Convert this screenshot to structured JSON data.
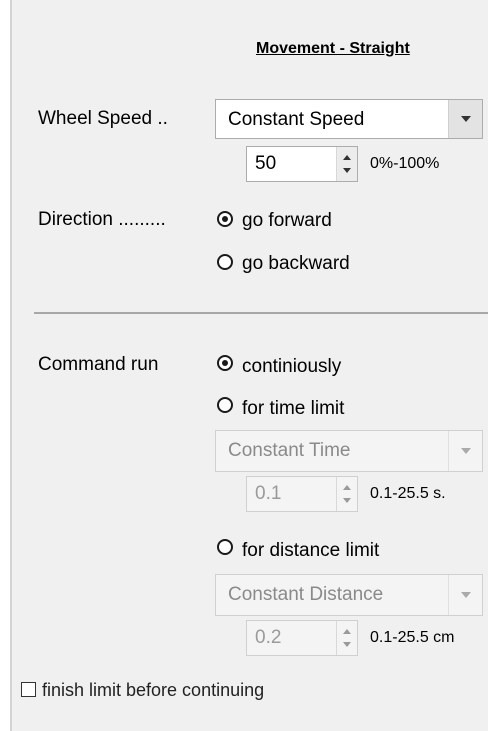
{
  "panel": {
    "title": "Movement - Straight"
  },
  "wheel_speed": {
    "label": "Wheel Speed ..",
    "mode": "Constant Speed",
    "value": "50",
    "range": "0%-100%"
  },
  "direction": {
    "label": "Direction .........",
    "options": [
      {
        "label": "go forward",
        "selected": true
      },
      {
        "label": "go backward",
        "selected": false
      }
    ]
  },
  "command_run": {
    "label": "Command run",
    "options": [
      {
        "label": "continiously",
        "selected": true
      },
      {
        "label": "for time limit",
        "selected": false
      },
      {
        "label": "for distance limit",
        "selected": false
      }
    ],
    "time": {
      "mode": "Constant Time",
      "value": "0.1",
      "range": "0.1-25.5 s."
    },
    "distance": {
      "mode": "Constant Distance",
      "value": "0.2",
      "range": "0.1-25.5 cm"
    }
  },
  "finish_limit": {
    "label": "finish limit before continuing",
    "checked": false
  }
}
